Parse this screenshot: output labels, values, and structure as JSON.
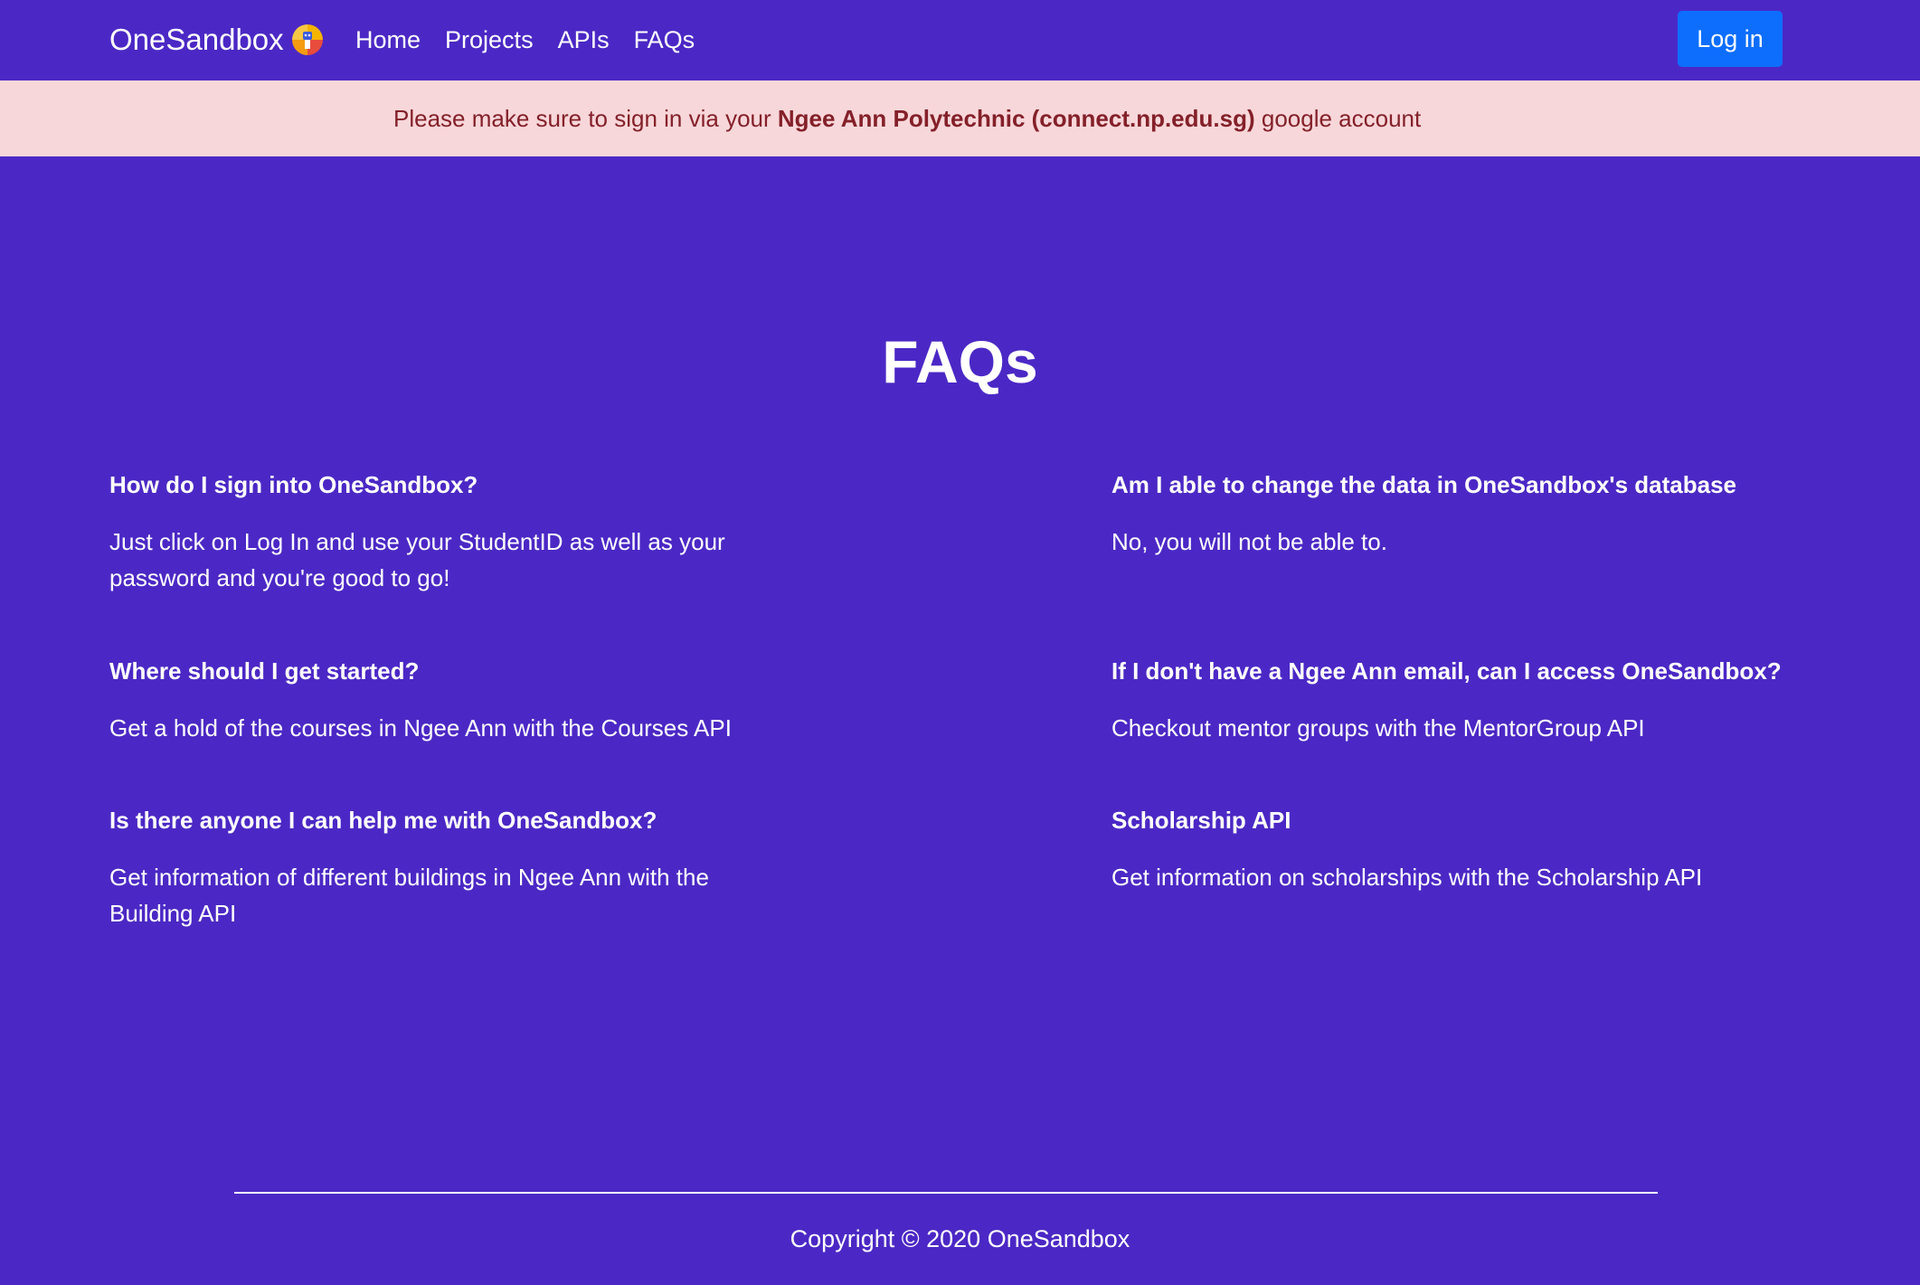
{
  "nav": {
    "brand": "OneSandbox",
    "logo_icon": "robot-logo-icon",
    "links": [
      "Home",
      "Projects",
      "APIs",
      "FAQs"
    ],
    "login_label": "Log in"
  },
  "alert": {
    "prefix": "Please make sure to sign in via your ",
    "highlight": "Ngee Ann Polytechnic (connect.np.edu.sg)",
    "suffix": " google account"
  },
  "page": {
    "title": "FAQs"
  },
  "faqs": [
    {
      "question": "How do I sign into OneSandbox?",
      "answer": "Just click on Log In and use your StudentID as well as your password and you're good to go!"
    },
    {
      "question": "Am I able to change the data in OneSandbox's database",
      "answer": "No, you will not be able to."
    },
    {
      "question": "Where should I get started?",
      "answer": "Get a hold of the courses in Ngee Ann with the Courses API"
    },
    {
      "question": "If I don't have a Ngee Ann email, can I access OneSandbox?",
      "answer": "Checkout mentor groups with the MentorGroup API"
    },
    {
      "question": "Is there anyone I can help me with OneSandbox?",
      "answer": "Get information of different buildings in Ngee Ann with the Building API"
    },
    {
      "question": "Scholarship API",
      "answer": "Get information on scholarships with the Scholarship API"
    }
  ],
  "footer": {
    "copyright": "Copyright © 2020 OneSandbox"
  },
  "colors": {
    "background": "#4b28c5",
    "login_button": "#0d6efd",
    "alert_bg": "#f8d7da",
    "alert_text": "#842029"
  }
}
